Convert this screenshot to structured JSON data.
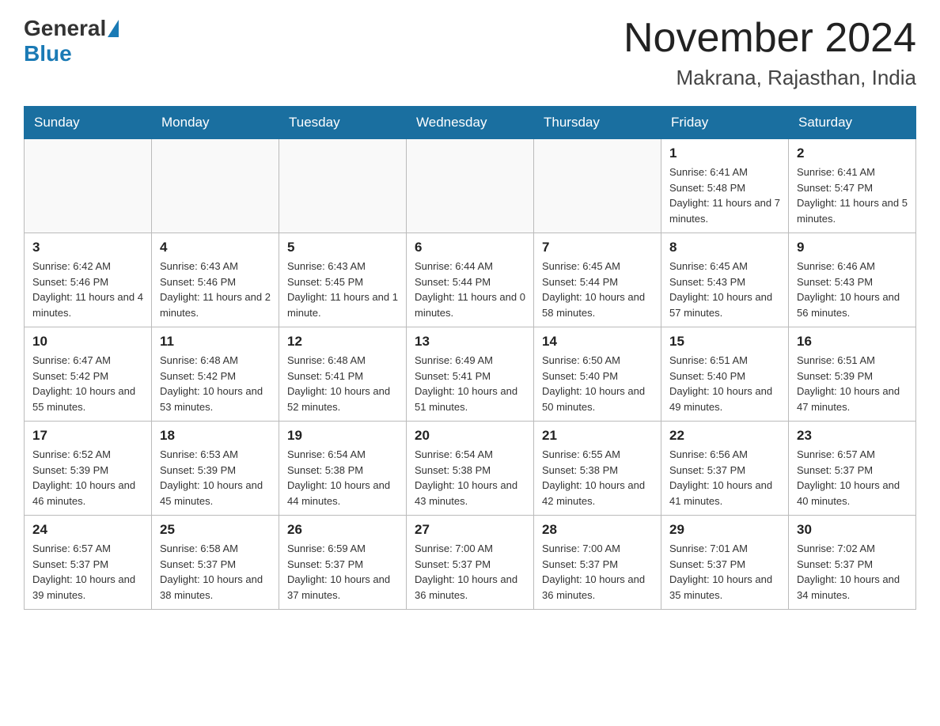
{
  "header": {
    "logo_general": "General",
    "logo_blue": "Blue",
    "month_title": "November 2024",
    "location": "Makrana, Rajasthan, India"
  },
  "days_of_week": [
    "Sunday",
    "Monday",
    "Tuesday",
    "Wednesday",
    "Thursday",
    "Friday",
    "Saturday"
  ],
  "weeks": [
    [
      {
        "day": "",
        "info": ""
      },
      {
        "day": "",
        "info": ""
      },
      {
        "day": "",
        "info": ""
      },
      {
        "day": "",
        "info": ""
      },
      {
        "day": "",
        "info": ""
      },
      {
        "day": "1",
        "info": "Sunrise: 6:41 AM\nSunset: 5:48 PM\nDaylight: 11 hours and 7 minutes."
      },
      {
        "day": "2",
        "info": "Sunrise: 6:41 AM\nSunset: 5:47 PM\nDaylight: 11 hours and 5 minutes."
      }
    ],
    [
      {
        "day": "3",
        "info": "Sunrise: 6:42 AM\nSunset: 5:46 PM\nDaylight: 11 hours and 4 minutes."
      },
      {
        "day": "4",
        "info": "Sunrise: 6:43 AM\nSunset: 5:46 PM\nDaylight: 11 hours and 2 minutes."
      },
      {
        "day": "5",
        "info": "Sunrise: 6:43 AM\nSunset: 5:45 PM\nDaylight: 11 hours and 1 minute."
      },
      {
        "day": "6",
        "info": "Sunrise: 6:44 AM\nSunset: 5:44 PM\nDaylight: 11 hours and 0 minutes."
      },
      {
        "day": "7",
        "info": "Sunrise: 6:45 AM\nSunset: 5:44 PM\nDaylight: 10 hours and 58 minutes."
      },
      {
        "day": "8",
        "info": "Sunrise: 6:45 AM\nSunset: 5:43 PM\nDaylight: 10 hours and 57 minutes."
      },
      {
        "day": "9",
        "info": "Sunrise: 6:46 AM\nSunset: 5:43 PM\nDaylight: 10 hours and 56 minutes."
      }
    ],
    [
      {
        "day": "10",
        "info": "Sunrise: 6:47 AM\nSunset: 5:42 PM\nDaylight: 10 hours and 55 minutes."
      },
      {
        "day": "11",
        "info": "Sunrise: 6:48 AM\nSunset: 5:42 PM\nDaylight: 10 hours and 53 minutes."
      },
      {
        "day": "12",
        "info": "Sunrise: 6:48 AM\nSunset: 5:41 PM\nDaylight: 10 hours and 52 minutes."
      },
      {
        "day": "13",
        "info": "Sunrise: 6:49 AM\nSunset: 5:41 PM\nDaylight: 10 hours and 51 minutes."
      },
      {
        "day": "14",
        "info": "Sunrise: 6:50 AM\nSunset: 5:40 PM\nDaylight: 10 hours and 50 minutes."
      },
      {
        "day": "15",
        "info": "Sunrise: 6:51 AM\nSunset: 5:40 PM\nDaylight: 10 hours and 49 minutes."
      },
      {
        "day": "16",
        "info": "Sunrise: 6:51 AM\nSunset: 5:39 PM\nDaylight: 10 hours and 47 minutes."
      }
    ],
    [
      {
        "day": "17",
        "info": "Sunrise: 6:52 AM\nSunset: 5:39 PM\nDaylight: 10 hours and 46 minutes."
      },
      {
        "day": "18",
        "info": "Sunrise: 6:53 AM\nSunset: 5:39 PM\nDaylight: 10 hours and 45 minutes."
      },
      {
        "day": "19",
        "info": "Sunrise: 6:54 AM\nSunset: 5:38 PM\nDaylight: 10 hours and 44 minutes."
      },
      {
        "day": "20",
        "info": "Sunrise: 6:54 AM\nSunset: 5:38 PM\nDaylight: 10 hours and 43 minutes."
      },
      {
        "day": "21",
        "info": "Sunrise: 6:55 AM\nSunset: 5:38 PM\nDaylight: 10 hours and 42 minutes."
      },
      {
        "day": "22",
        "info": "Sunrise: 6:56 AM\nSunset: 5:37 PM\nDaylight: 10 hours and 41 minutes."
      },
      {
        "day": "23",
        "info": "Sunrise: 6:57 AM\nSunset: 5:37 PM\nDaylight: 10 hours and 40 minutes."
      }
    ],
    [
      {
        "day": "24",
        "info": "Sunrise: 6:57 AM\nSunset: 5:37 PM\nDaylight: 10 hours and 39 minutes."
      },
      {
        "day": "25",
        "info": "Sunrise: 6:58 AM\nSunset: 5:37 PM\nDaylight: 10 hours and 38 minutes."
      },
      {
        "day": "26",
        "info": "Sunrise: 6:59 AM\nSunset: 5:37 PM\nDaylight: 10 hours and 37 minutes."
      },
      {
        "day": "27",
        "info": "Sunrise: 7:00 AM\nSunset: 5:37 PM\nDaylight: 10 hours and 36 minutes."
      },
      {
        "day": "28",
        "info": "Sunrise: 7:00 AM\nSunset: 5:37 PM\nDaylight: 10 hours and 36 minutes."
      },
      {
        "day": "29",
        "info": "Sunrise: 7:01 AM\nSunset: 5:37 PM\nDaylight: 10 hours and 35 minutes."
      },
      {
        "day": "30",
        "info": "Sunrise: 7:02 AM\nSunset: 5:37 PM\nDaylight: 10 hours and 34 minutes."
      }
    ]
  ]
}
